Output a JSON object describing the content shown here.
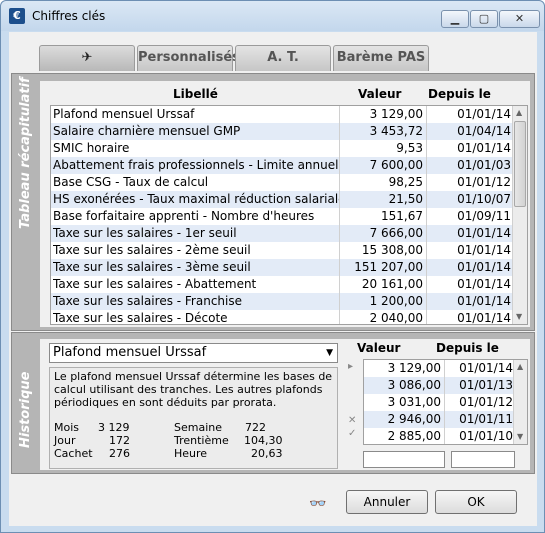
{
  "window": {
    "title": "Chiffres clés",
    "icon": "€",
    "buttons": {
      "minimize": "▁",
      "maximize": "▢",
      "close": "✕"
    }
  },
  "tabs": [
    {
      "label": "✈",
      "icon": "airplane-icon"
    },
    {
      "label": "Personnalisés"
    },
    {
      "label": "A. T."
    },
    {
      "label": "Barème PAS"
    }
  ],
  "summary": {
    "section_label": "Tableau récapitulatif",
    "columns": {
      "label": "Libellé",
      "value": "Valeur",
      "since": "Depuis le"
    },
    "rows": [
      {
        "label": "Plafond mensuel Urssaf",
        "value": "3 129,00",
        "since": "01/01/14"
      },
      {
        "label": "Salaire charnière mensuel GMP",
        "value": "3 453,72",
        "since": "01/04/14"
      },
      {
        "label": "SMIC horaire",
        "value": "9,53",
        "since": "01/01/14"
      },
      {
        "label": "Abattement frais professionnels - Limite annuelle",
        "value": "7 600,00",
        "since": "01/01/03"
      },
      {
        "label": "Base CSG - Taux de calcul",
        "value": "98,25",
        "since": "01/01/12"
      },
      {
        "label": "HS exonérées - Taux maximal réduction salariale",
        "value": "21,50",
        "since": "01/10/07"
      },
      {
        "label": "Base forfaitaire apprenti - Nombre d'heures",
        "value": "151,67",
        "since": "01/09/11"
      },
      {
        "label": "Taxe sur les salaires - 1er seuil",
        "value": "7 666,00",
        "since": "01/01/14"
      },
      {
        "label": "Taxe sur les salaires - 2ème seuil",
        "value": "15 308,00",
        "since": "01/01/14"
      },
      {
        "label": "Taxe sur les salaires - 3ème seuil",
        "value": "151 207,00",
        "since": "01/01/14"
      },
      {
        "label": "Taxe sur les salaires - Abattement",
        "value": "20 161,00",
        "since": "01/01/14"
      },
      {
        "label": "Taxe sur les salaires - Franchise",
        "value": "1 200,00",
        "since": "01/01/14"
      },
      {
        "label": "Taxe sur les salaires - Décote",
        "value": "2 040,00",
        "since": "01/01/14"
      }
    ]
  },
  "history": {
    "section_label": "Historique",
    "selected": "Plafond mensuel Urssaf",
    "description": "Le plafond mensuel Urssaf détermine les bases de calcul utilisant des tranches. Les autres plafonds périodiques en sont déduits par prorata.",
    "periods": {
      "mois_label": "Mois",
      "mois_value": "3 129",
      "semaine_label": "Semaine",
      "semaine_value": "722",
      "jour_label": "Jour",
      "jour_value": "172",
      "trentieme_label": "Trentième",
      "trentieme_value": "104,30",
      "cachet_label": "Cachet",
      "cachet_value": "276",
      "heure_label": "Heure",
      "heure_value": "20,63"
    },
    "columns": {
      "value": "Valeur",
      "since": "Depuis le"
    },
    "rows": [
      {
        "value": "3 129,00",
        "since": "01/01/14"
      },
      {
        "value": "3 086,00",
        "since": "01/01/13"
      },
      {
        "value": "3 031,00",
        "since": "01/01/12"
      },
      {
        "value": "2 946,00",
        "since": "01/01/11"
      },
      {
        "value": "2 885,00",
        "since": "01/01/10"
      }
    ],
    "new_value": "",
    "new_since": ""
  },
  "footer": {
    "cancel_label": "Annuler",
    "ok_label": "OK",
    "glasses_icon": "glasses-icon"
  }
}
